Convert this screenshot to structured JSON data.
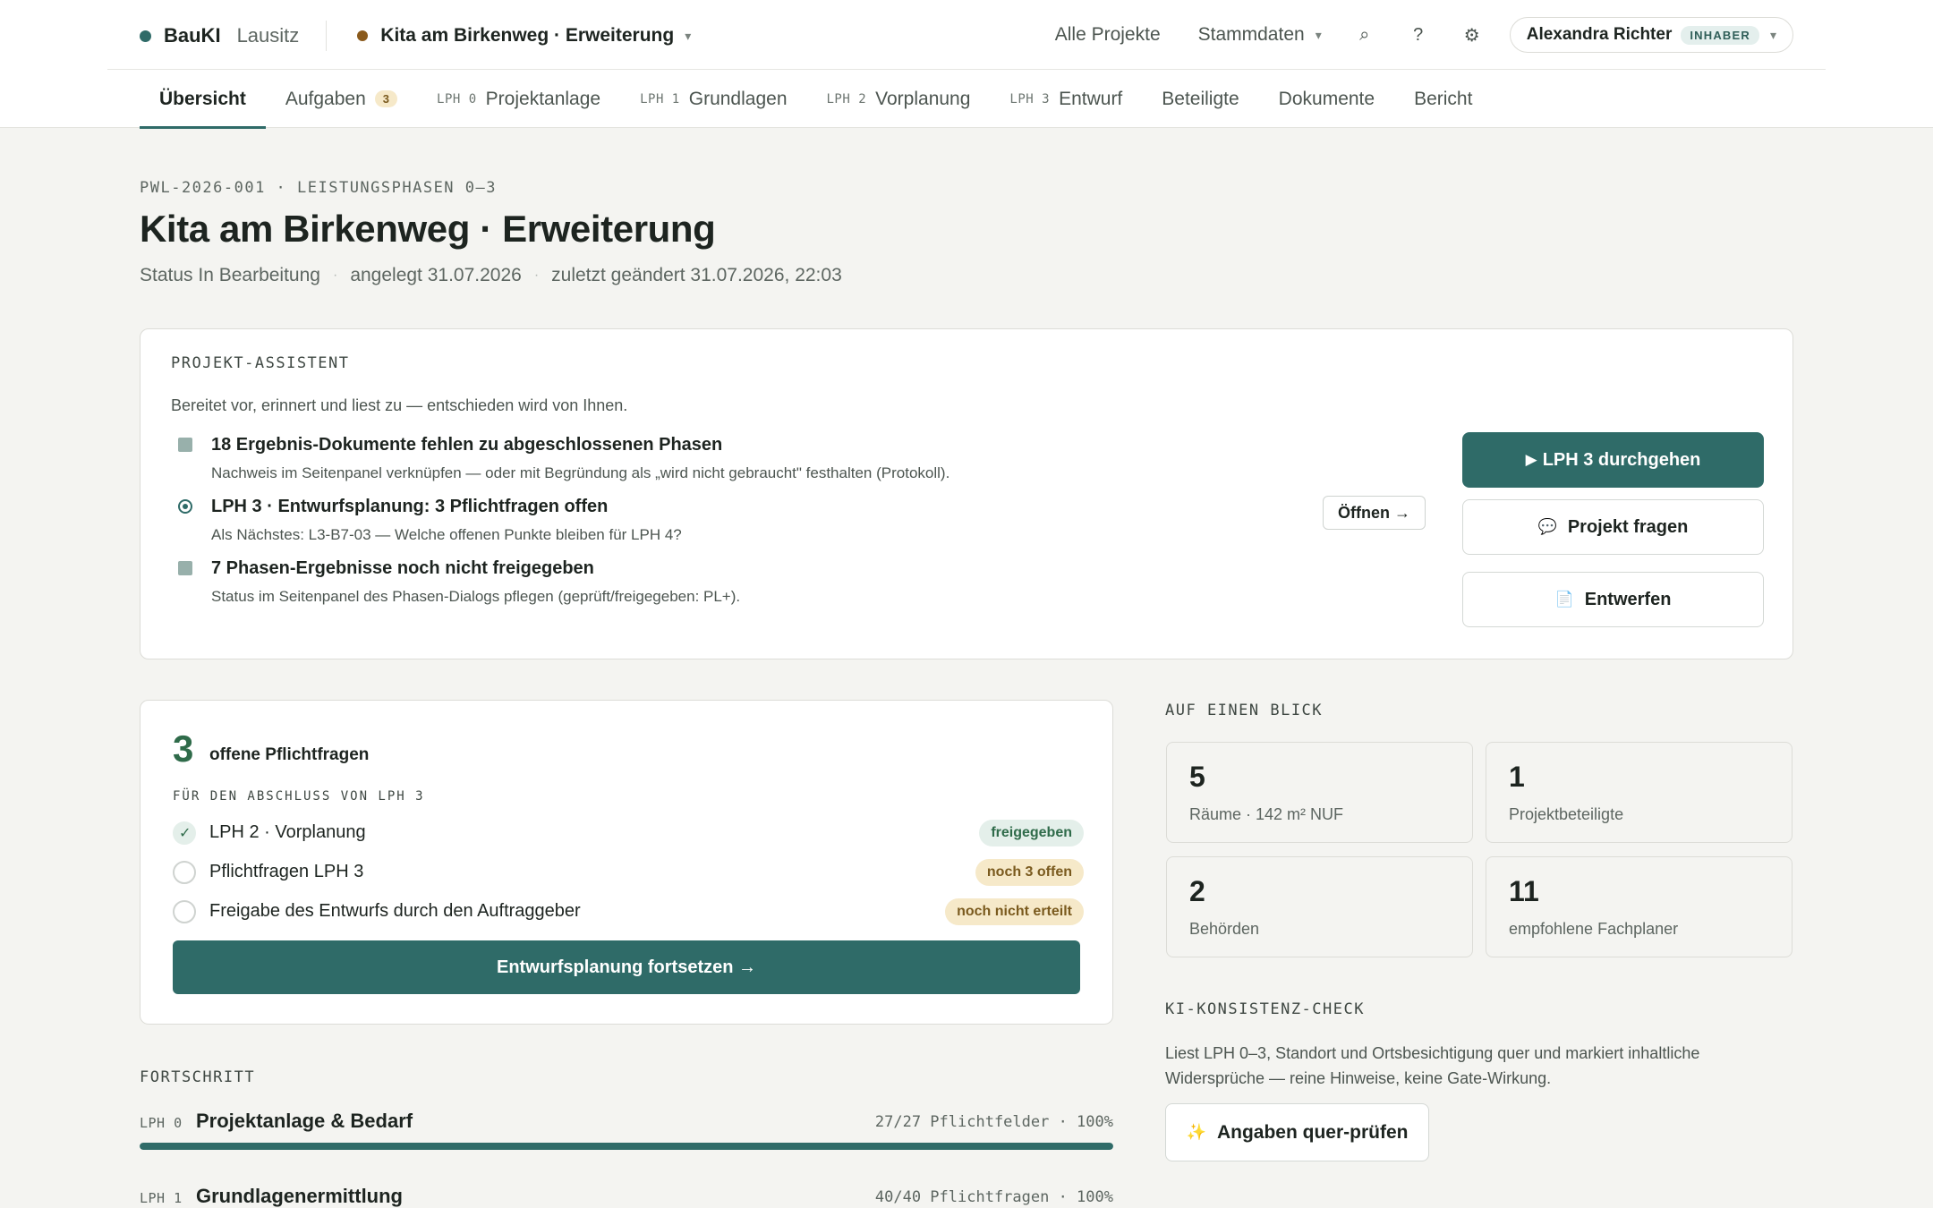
{
  "brand": {
    "name": "BauKI",
    "region": "Lausitz",
    "dot_color": "#2f6b68"
  },
  "project_switcher": {
    "name": "Kita am Birkenweg · Erweiterung",
    "dot_color": "#8a5a1c",
    "caret": "▾"
  },
  "topnav": {
    "all_projects": "Alle Projekte",
    "master_data": "Stammdaten",
    "master_data_caret": "▾",
    "search_icon": "⌕",
    "help_icon": "?",
    "settings_icon": "⚙"
  },
  "user": {
    "name": "Alexandra Richter",
    "role": "INHABER",
    "caret": "▾"
  },
  "tabs": [
    {
      "label": "Übersicht",
      "active": true
    },
    {
      "label": "Aufgaben",
      "count": "3"
    },
    {
      "lph": "LPH 0",
      "label": "Projektanlage"
    },
    {
      "lph": "LPH 1",
      "label": "Grundlagen"
    },
    {
      "lph": "LPH 2",
      "label": "Vorplanung"
    },
    {
      "lph": "LPH 3",
      "label": "Entwurf"
    },
    {
      "label": "Beteiligte"
    },
    {
      "label": "Dokumente"
    },
    {
      "label": "Bericht"
    }
  ],
  "header": {
    "eyebrow": "PWL-2026-001 · LEISTUNGSPHASEN 0–3",
    "title": "Kita am Birkenweg · Erweiterung",
    "status": "Status In Bearbeitung",
    "created": "angelegt 31.07.2026",
    "modified": "zuletzt geändert 31.07.2026, 22:03",
    "sep": "·"
  },
  "assistant": {
    "label": "PROJEKT-ASSISTENT",
    "intro": "Bereitet vor, erinnert und liest zu — entschieden wird von Ihnen.",
    "items": [
      {
        "title": "18 Ergebnis-Dokumente fehlen zu abgeschlossenen Phasen",
        "desc": "Nachweis im Seitenpanel verknüpfen — oder mit Begründung als „wird nicht gebraucht\" festhalten (Protokoll).",
        "icon": "square"
      },
      {
        "title": "LPH 3 · Entwurfsplanung: 3 Pflichtfragen offen",
        "desc": "Als Nächstes: L3-B7-03 — Welche offenen Punkte bleiben für LPH 4?",
        "icon": "radio"
      },
      {
        "title": "7 Phasen-Ergebnisse noch nicht freigegeben",
        "desc": "Status im Seitenpanel des Phasen-Dialogs pflegen (geprüft/freigegeben: PL+).",
        "icon": "square"
      }
    ],
    "open_button": "Öffnen →",
    "actions": {
      "primary": {
        "icon": "▶",
        "label": "LPH 3 durchgehen"
      },
      "ask": {
        "icon": "💬",
        "label": "Projekt fragen"
      },
      "draft": {
        "icon": "📄",
        "label": "Entwerfen"
      }
    }
  },
  "pflichtfragen": {
    "count": "3",
    "count_label": "offene Pflichtfragen",
    "section": "FÜR DEN ABSCHLUSS VON LPH 3",
    "rows": [
      {
        "label": "LPH 2 · Vorplanung",
        "status": "freigegeben",
        "done": true
      },
      {
        "label": "Pflichtfragen LPH 3",
        "status": "noch 3 offen",
        "done": false
      },
      {
        "label": "Freigabe des Entwurfs durch den Auftraggeber",
        "status": "noch nicht erteilt",
        "done": false
      }
    ],
    "continue_button": "Entwurfsplanung fortsetzen →"
  },
  "glance": {
    "label": "AUF EINEN BLICK",
    "stats": [
      {
        "num": "5",
        "label": "Räume · 142 m² NUF"
      },
      {
        "num": "1",
        "label": "Projektbeteiligte"
      },
      {
        "num": "2",
        "label": "Behörden"
      },
      {
        "num": "11",
        "label": "empfohlene Fachplaner"
      }
    ]
  },
  "ki_check": {
    "label": "KI-KONSISTENZ-CHECK",
    "desc": "Liest LPH 0–3, Standort und Ortsbesichtigung quer und markiert inhaltliche Widersprüche — reine Hinweise, keine Gate-Wirkung.",
    "button_icon": "✨",
    "button_label": "Angaben quer-prüfen"
  },
  "progress": {
    "label": "FORTSCHRITT",
    "rows": [
      {
        "lph": "LPH 0",
        "title": "Projektanlage & Bedarf",
        "meta": "27/27 Pflichtfelder · 100%",
        "percent": 100
      },
      {
        "lph": "LPH 1",
        "title": "Grundlagenermittlung",
        "meta": "40/40 Pflichtfragen · 100%",
        "percent": 100
      }
    ]
  }
}
